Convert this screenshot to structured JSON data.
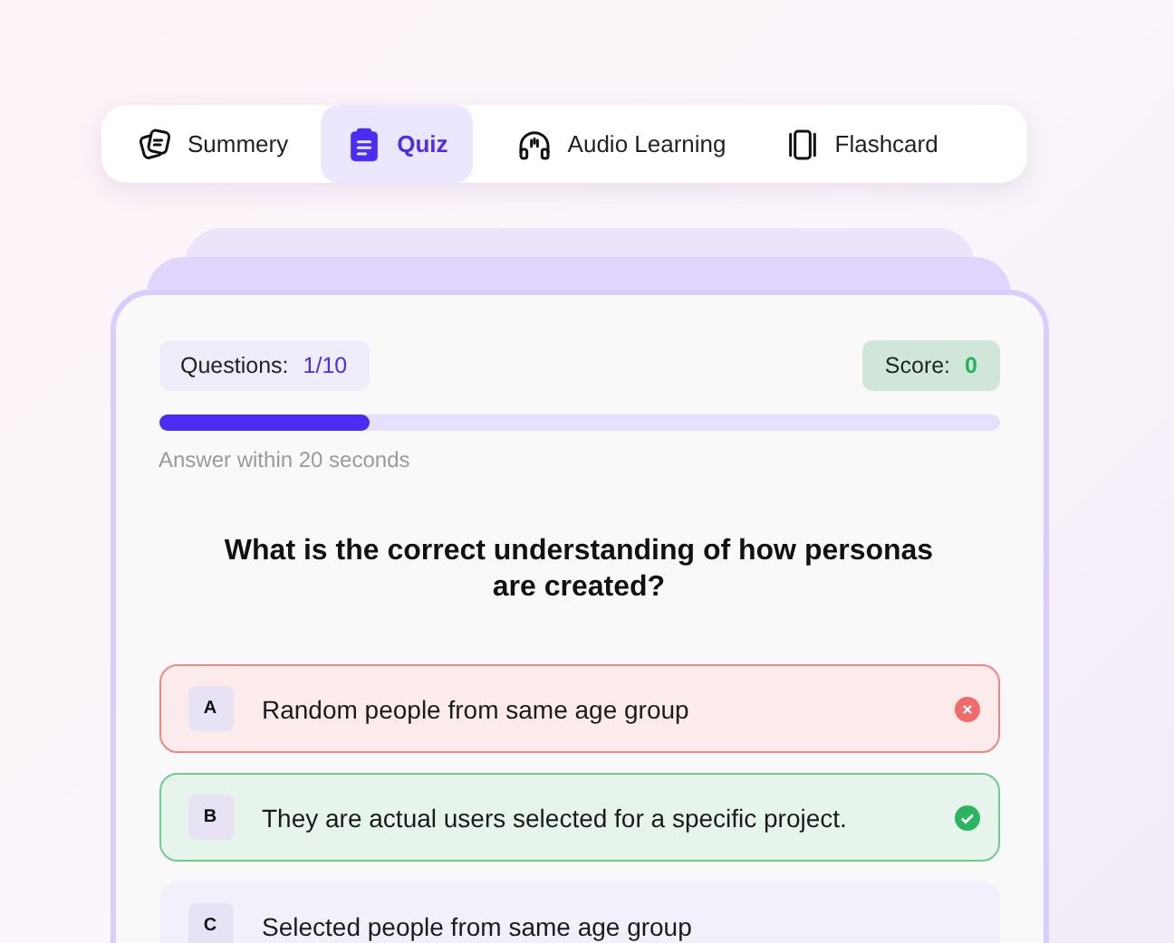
{
  "tabs": [
    {
      "label": "Summery",
      "selected": false
    },
    {
      "label": "Quiz",
      "selected": true
    },
    {
      "label": "Audio Learning",
      "selected": false
    },
    {
      "label": "Flashcard",
      "selected": false
    }
  ],
  "quiz": {
    "questions_label": "Questions:",
    "questions_value": "1/10",
    "score_label": "Score:",
    "score_value": "0",
    "progress": {
      "level": 0.25
    },
    "hint": "Answer within 20 seconds",
    "question": "What is the correct understanding of how personas are created?",
    "options": [
      {
        "letter": "A",
        "text": "Random people from same age group",
        "kind": "wrong"
      },
      {
        "letter": "B",
        "text": "They are actual users selected for a specific project.",
        "kind": "correct"
      },
      {
        "letter": "C",
        "text": "Selected people from same age group",
        "kind": "none"
      }
    ]
  }
}
